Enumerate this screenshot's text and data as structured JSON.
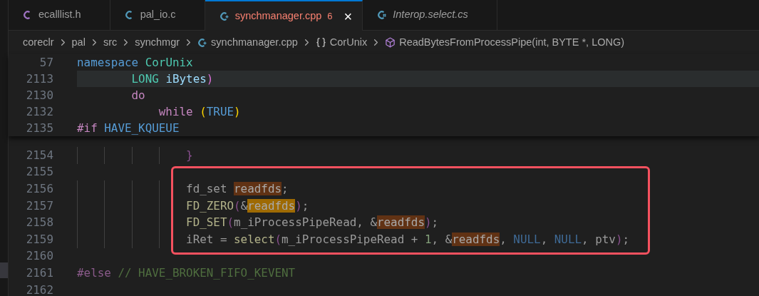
{
  "tabs": [
    {
      "label": "ecalllist.h",
      "kind": "c-header",
      "selected": false,
      "preview": false,
      "error": false
    },
    {
      "label": "pal_io.c",
      "kind": "c",
      "selected": false,
      "preview": false,
      "error": false
    },
    {
      "label": "synchmanager.cpp",
      "kind": "cpp",
      "selected": true,
      "preview": false,
      "error": true,
      "problems": "6",
      "close": "×"
    },
    {
      "label": "Interop.select.cs",
      "kind": "csharp",
      "selected": false,
      "preview": true,
      "error": false
    }
  ],
  "breadcrumbs": [
    {
      "label": "coreclr",
      "kind": "folder"
    },
    {
      "label": "pal",
      "kind": "folder"
    },
    {
      "label": "src",
      "kind": "folder"
    },
    {
      "label": "synchmgr",
      "kind": "folder"
    },
    {
      "label": "synchmanager.cpp",
      "kind": "file"
    },
    {
      "label": "CorUnix",
      "kind": "namespace"
    },
    {
      "label": "ReadBytesFromProcessPipe(int, BYTE *, LONG)",
      "kind": "method"
    }
  ],
  "sticky_lines": [
    {
      "number": "57",
      "current": false,
      "tokens": [
        {
          "text": "namespace",
          "kind": "keyword"
        },
        {
          "text": " CorUnix",
          "kind": "type"
        }
      ]
    },
    {
      "number": "2113",
      "current": true,
      "tokens": [
        {
          "text": "        LONG",
          "kind": "type"
        },
        {
          "text": " iBytes",
          "kind": "variable"
        },
        {
          "text": ")",
          "kind": "bracket2"
        }
      ]
    },
    {
      "number": "2130",
      "current": false,
      "tokens": [
        {
          "text": "        do",
          "kind": "control"
        }
      ]
    },
    {
      "number": "2132",
      "current": false,
      "tokens": [
        {
          "text": "            while",
          "kind": "control"
        },
        {
          "text": " (",
          "kind": "bracket1"
        },
        {
          "text": "TRUE",
          "kind": "keyword"
        },
        {
          "text": ")",
          "kind": "bracket1"
        }
      ]
    },
    {
      "number": "2135",
      "current": false,
      "tokens": [
        {
          "text": "#if",
          "kind": "control"
        },
        {
          "text": " HAVE_KQUEUE",
          "kind": "keyword"
        }
      ]
    }
  ],
  "lines": [
    {
      "number": "2154",
      "tokens": [
        {
          "text": "                }",
          "kind": "dim-bracket"
        }
      ]
    },
    {
      "number": "2155"
    },
    {
      "number": "2156",
      "tokens": [
        {
          "text": "                fd_set ",
          "kind": "dim"
        },
        {
          "text": "readfds",
          "kind": "match"
        },
        {
          "text": ";",
          "kind": "dim"
        }
      ]
    },
    {
      "number": "2157",
      "tokens": [
        {
          "text": "                FD_ZERO",
          "kind": "dim-function"
        },
        {
          "text": "(",
          "kind": "dim-bracket"
        },
        {
          "text": "&",
          "kind": "dim"
        },
        {
          "text": "readfds",
          "kind": "match-current"
        },
        {
          "text": ")",
          "kind": "dim-bracket"
        },
        {
          "text": ";",
          "kind": "dim"
        }
      ]
    },
    {
      "number": "2158",
      "tokens": [
        {
          "text": "                FD_SET",
          "kind": "dim-function"
        },
        {
          "text": "(",
          "kind": "dim-bracket"
        },
        {
          "text": "m_iProcessPipeRead, &",
          "kind": "dim"
        },
        {
          "text": "readfds",
          "kind": "match"
        },
        {
          "text": ")",
          "kind": "dim-bracket"
        },
        {
          "text": ";",
          "kind": "dim"
        }
      ]
    },
    {
      "number": "2159",
      "tokens": [
        {
          "text": "                iRet = ",
          "kind": "dim"
        },
        {
          "text": "select",
          "kind": "dim-function"
        },
        {
          "text": "(",
          "kind": "dim-bracket"
        },
        {
          "text": "m_iProcessPipeRead + ",
          "kind": "dim"
        },
        {
          "text": "1",
          "kind": "dim-number"
        },
        {
          "text": ", &",
          "kind": "dim"
        },
        {
          "text": "readfds",
          "kind": "match"
        },
        {
          "text": ", ",
          "kind": "dim"
        },
        {
          "text": "NULL",
          "kind": "dim-keyword"
        },
        {
          "text": ", ",
          "kind": "dim"
        },
        {
          "text": "NULL",
          "kind": "dim-keyword"
        },
        {
          "text": ", ptv",
          "kind": "dim"
        },
        {
          "text": ")",
          "kind": "dim-bracket"
        },
        {
          "text": ";",
          "kind": "dim"
        }
      ]
    },
    {
      "number": "2160"
    },
    {
      "number": "2161",
      "tokens": [
        {
          "text": "#else",
          "kind": "dim-control"
        },
        {
          "text": " // HAVE_BROKEN_FIFO_KEVENT",
          "kind": "dim-comment"
        }
      ]
    },
    {
      "number": "2162"
    }
  ]
}
